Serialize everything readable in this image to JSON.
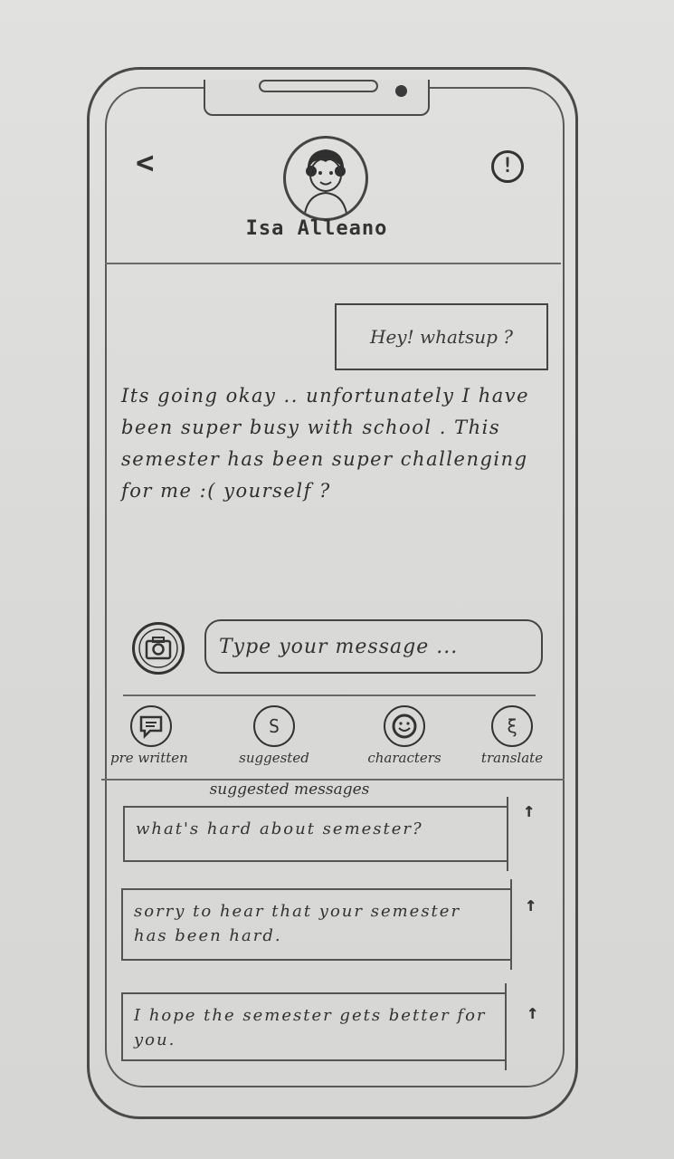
{
  "header": {
    "contact_name": "Isa  Alleano",
    "back_icon": "chevron-left-icon",
    "info_icon": "exclamation-circle-icon",
    "info_glyph": "!",
    "back_glyph": "<"
  },
  "chat": {
    "outgoing": "Hey! whatsup ?",
    "incoming": "Its going okay .. unfortunately I have been super busy with school . This semester has been super challenging for me  :( yourself ?"
  },
  "composer": {
    "placeholder": "Type your message ...",
    "camera_icon": "camera-icon"
  },
  "toolbar": {
    "items": [
      {
        "label": "pre written",
        "icon": "chat-bubble-icon"
      },
      {
        "label": "suggested",
        "icon": "s-letter-icon",
        "glyph": "S"
      },
      {
        "label": "characters",
        "icon": "smiley-icon"
      },
      {
        "label": "translate",
        "icon": "translate-icon",
        "glyph": "ξ"
      }
    ]
  },
  "suggestions": {
    "title": "suggested messages",
    "send_glyph": "↑",
    "items": [
      {
        "text": "what's hard about semester?"
      },
      {
        "text": "sorry to hear that your semester has been hard."
      },
      {
        "text": "I hope the semester gets better for you."
      }
    ]
  }
}
